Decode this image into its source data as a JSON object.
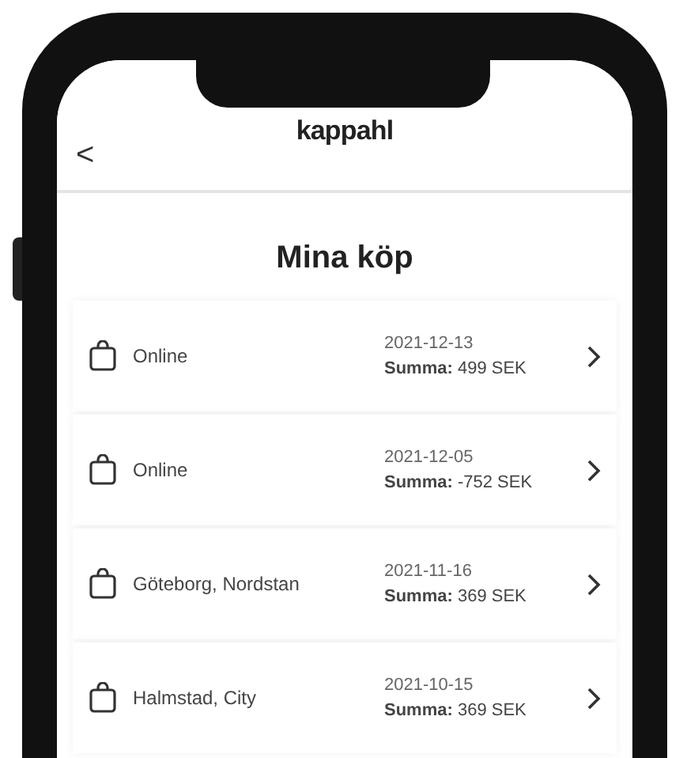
{
  "app_bar": {
    "logo": "kappahl",
    "back": "<"
  },
  "title": "Mina köp",
  "purchases": [
    {
      "store": "Online",
      "date": "2021-12-13",
      "sum": "**Summa:** 499 SEK"
    },
    {
      "store": "Online",
      "date": "2021-12-05",
      "sum": "**Summa:** -752 SEK"
    },
    {
      "store": "Göteborg, Nordstan",
      "date": "2021-11-16",
      "sum": "**Summa:** 369 SEK"
    },
    {
      "store": "Halmstad, City",
      "date": "2021-10-15",
      "sum": "**Summa:** 369 SEK"
    }
  ]
}
